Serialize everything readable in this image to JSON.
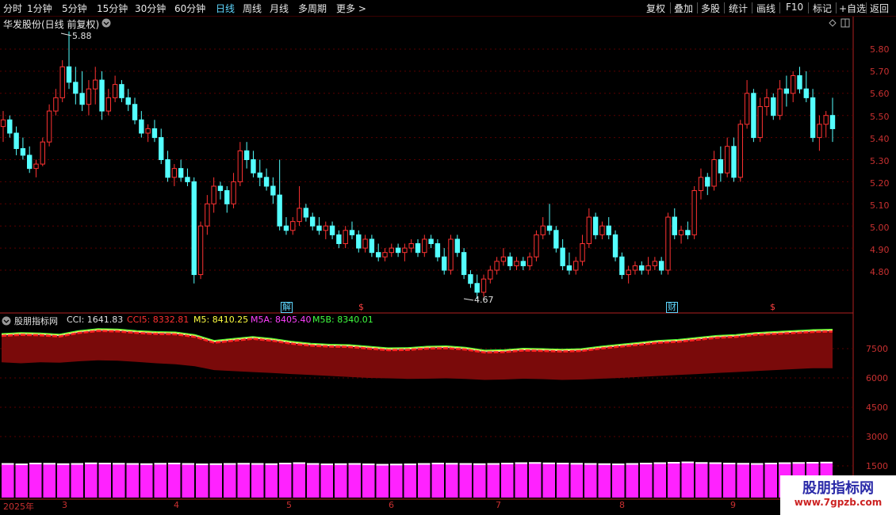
{
  "toolbar": {
    "tabs": [
      "分时",
      "1分钟",
      "5分钟",
      "15分钟",
      "30分钟",
      "60分钟",
      "日线",
      "周线",
      "月线",
      "多周期",
      "更多 >"
    ],
    "active_tab": "日线",
    "right_buttons": [
      "复权",
      "叠加",
      "多股",
      "统计",
      "画线",
      "F10",
      "标记",
      "+自选",
      "返回"
    ]
  },
  "chart_header": {
    "title": "华发股份(日线 前复权)",
    "high_label": "5.88",
    "low_label": "4.67"
  },
  "price_axis": {
    "ticks": [
      "5.80",
      "5.70",
      "5.60",
      "5.50",
      "5.40",
      "5.30",
      "5.20",
      "5.10",
      "5.00",
      "4.90",
      "4.80"
    ]
  },
  "event_markers": [
    {
      "text": "解",
      "color": "#5fd7ff"
    },
    {
      "text": "$",
      "color": "#ff4040"
    },
    {
      "text": "财",
      "color": "#5fd7ff"
    },
    {
      "text": "$",
      "color": "#ff4040"
    }
  ],
  "indicator": {
    "name": "股朋指标网",
    "cci": "CCI: 1641.83",
    "cci5": "CCI5: 8332.81",
    "m5": "M5: 8410.25",
    "m5a": "M5A: 8405.40",
    "m5b": "M5B: 8340.01",
    "colors": {
      "cci": "#e0e0e0",
      "cci5": "#ff3030",
      "m5": "#ffff40",
      "m5a": "#ff40ff",
      "m5b": "#40ff40"
    },
    "axis": [
      "7500",
      "6000",
      "4500",
      "3000",
      "1500"
    ]
  },
  "date_axis": {
    "labels": [
      "2025年",
      "3",
      "4",
      "5",
      "6",
      "7",
      "8",
      "9"
    ]
  },
  "watermark": {
    "title": "股朋指标网",
    "url": "www.7gpzb.com"
  },
  "colors": {
    "up": "#ff3232",
    "down": "#54ffff",
    "grid": "#5a0000",
    "axis": "#c83030",
    "volume": "#ff22ff"
  },
  "chart_data": {
    "type": "candlestick",
    "ylim": [
      4.67,
      5.88
    ],
    "candles": [
      [
        5.45,
        5.52,
        5.38,
        5.48
      ],
      [
        5.48,
        5.5,
        5.4,
        5.42
      ],
      [
        5.42,
        5.45,
        5.32,
        5.35
      ],
      [
        5.35,
        5.4,
        5.3,
        5.32
      ],
      [
        5.32,
        5.36,
        5.24,
        5.26
      ],
      [
        5.26,
        5.3,
        5.22,
        5.28
      ],
      [
        5.28,
        5.4,
        5.27,
        5.38
      ],
      [
        5.38,
        5.55,
        5.36,
        5.52
      ],
      [
        5.52,
        5.62,
        5.5,
        5.58
      ],
      [
        5.58,
        5.75,
        5.56,
        5.72
      ],
      [
        5.72,
        5.88,
        5.62,
        5.65
      ],
      [
        5.65,
        5.72,
        5.55,
        5.6
      ],
      [
        5.6,
        5.7,
        5.52,
        5.55
      ],
      [
        5.55,
        5.66,
        5.5,
        5.62
      ],
      [
        5.62,
        5.72,
        5.55,
        5.66
      ],
      [
        5.66,
        5.7,
        5.48,
        5.52
      ],
      [
        5.52,
        5.62,
        5.5,
        5.58
      ],
      [
        5.58,
        5.68,
        5.56,
        5.64
      ],
      [
        5.64,
        5.66,
        5.56,
        5.58
      ],
      [
        5.58,
        5.62,
        5.52,
        5.55
      ],
      [
        5.55,
        5.58,
        5.46,
        5.48
      ],
      [
        5.48,
        5.52,
        5.4,
        5.42
      ],
      [
        5.42,
        5.46,
        5.38,
        5.44
      ],
      [
        5.44,
        5.48,
        5.38,
        5.4
      ],
      [
        5.4,
        5.44,
        5.28,
        5.3
      ],
      [
        5.3,
        5.34,
        5.2,
        5.22
      ],
      [
        5.22,
        5.28,
        5.18,
        5.26
      ],
      [
        5.26,
        5.3,
        5.2,
        5.22
      ],
      [
        5.22,
        5.26,
        5.18,
        5.2
      ],
      [
        5.2,
        5.22,
        4.74,
        4.78
      ],
      [
        4.78,
        5.02,
        4.76,
        5.0
      ],
      [
        5.0,
        5.14,
        4.96,
        5.1
      ],
      [
        5.1,
        5.22,
        5.06,
        5.18
      ],
      [
        5.18,
        5.2,
        5.12,
        5.16
      ],
      [
        5.16,
        5.18,
        5.06,
        5.1
      ],
      [
        5.1,
        5.24,
        5.08,
        5.2
      ],
      [
        5.2,
        5.38,
        5.18,
        5.34
      ],
      [
        5.34,
        5.38,
        5.26,
        5.3
      ],
      [
        5.3,
        5.34,
        5.22,
        5.24
      ],
      [
        5.24,
        5.3,
        5.18,
        5.22
      ],
      [
        5.22,
        5.26,
        5.16,
        5.18
      ],
      [
        5.18,
        5.22,
        5.1,
        5.14
      ],
      [
        5.14,
        5.3,
        4.98,
        5.0
      ],
      [
        5.0,
        5.04,
        4.96,
        4.98
      ],
      [
        4.98,
        5.04,
        4.96,
        5.02
      ],
      [
        5.02,
        5.18,
        5.0,
        5.08
      ],
      [
        5.08,
        5.1,
        5.02,
        5.04
      ],
      [
        5.04,
        5.06,
        4.98,
        5.0
      ],
      [
        5.0,
        5.04,
        4.96,
        4.98
      ],
      [
        4.98,
        5.02,
        4.94,
        5.0
      ],
      [
        5.0,
        5.02,
        4.94,
        4.96
      ],
      [
        4.96,
        4.98,
        4.9,
        4.92
      ],
      [
        4.92,
        5.0,
        4.9,
        4.98
      ],
      [
        4.98,
        5.02,
        4.94,
        4.96
      ],
      [
        4.96,
        4.98,
        4.88,
        4.9
      ],
      [
        4.9,
        4.96,
        4.88,
        4.94
      ],
      [
        4.94,
        4.96,
        4.86,
        4.88
      ],
      [
        4.88,
        4.92,
        4.84,
        4.86
      ],
      [
        4.86,
        4.9,
        4.84,
        4.88
      ],
      [
        4.88,
        4.92,
        4.86,
        4.9
      ],
      [
        4.9,
        4.92,
        4.86,
        4.88
      ],
      [
        4.88,
        4.92,
        4.84,
        4.9
      ],
      [
        4.9,
        4.94,
        4.88,
        4.92
      ],
      [
        4.92,
        4.94,
        4.86,
        4.88
      ],
      [
        4.88,
        4.96,
        4.86,
        4.94
      ],
      [
        4.94,
        4.96,
        4.9,
        4.92
      ],
      [
        4.92,
        4.94,
        4.84,
        4.86
      ],
      [
        4.86,
        4.9,
        4.78,
        4.8
      ],
      [
        4.8,
        4.96,
        4.78,
        4.94
      ],
      [
        4.94,
        4.96,
        4.86,
        4.88
      ],
      [
        4.88,
        4.9,
        4.76,
        4.78
      ],
      [
        4.78,
        4.8,
        4.72,
        4.74
      ],
      [
        4.74,
        4.78,
        4.67,
        4.7
      ],
      [
        4.7,
        4.78,
        4.68,
        4.76
      ],
      [
        4.76,
        4.82,
        4.74,
        4.8
      ],
      [
        4.8,
        4.86,
        4.78,
        4.84
      ],
      [
        4.84,
        4.9,
        4.82,
        4.86
      ],
      [
        4.86,
        4.88,
        4.8,
        4.82
      ],
      [
        4.82,
        4.86,
        4.8,
        4.84
      ],
      [
        4.84,
        4.86,
        4.8,
        4.82
      ],
      [
        4.82,
        4.88,
        4.8,
        4.86
      ],
      [
        4.86,
        4.98,
        4.84,
        4.96
      ],
      [
        4.96,
        5.04,
        4.94,
        5.0
      ],
      [
        5.0,
        5.1,
        4.96,
        4.98
      ],
      [
        4.98,
        5.0,
        4.88,
        4.9
      ],
      [
        4.9,
        4.94,
        4.8,
        4.82
      ],
      [
        4.82,
        4.88,
        4.78,
        4.8
      ],
      [
        4.8,
        4.86,
        4.78,
        4.84
      ],
      [
        4.84,
        4.96,
        4.82,
        4.92
      ],
      [
        4.92,
        5.08,
        4.9,
        5.04
      ],
      [
        5.04,
        5.06,
        4.94,
        4.96
      ],
      [
        4.96,
        5.02,
        4.94,
        5.0
      ],
      [
        5.0,
        5.04,
        4.94,
        4.96
      ],
      [
        4.96,
        4.98,
        4.84,
        4.86
      ],
      [
        4.86,
        4.88,
        4.76,
        4.78
      ],
      [
        4.78,
        4.82,
        4.74,
        4.8
      ],
      [
        4.8,
        4.84,
        4.78,
        4.82
      ],
      [
        4.82,
        4.84,
        4.78,
        4.8
      ],
      [
        4.8,
        4.86,
        4.78,
        4.82
      ],
      [
        4.82,
        4.86,
        4.8,
        4.84
      ],
      [
        4.84,
        4.86,
        4.78,
        4.8
      ],
      [
        4.8,
        5.06,
        4.78,
        5.04
      ],
      [
        5.04,
        5.08,
        4.94,
        4.96
      ],
      [
        4.96,
        5.0,
        4.92,
        4.98
      ],
      [
        4.98,
        5.02,
        4.94,
        4.96
      ],
      [
        4.96,
        5.18,
        4.94,
        5.16
      ],
      [
        5.16,
        5.26,
        5.12,
        5.22
      ],
      [
        5.22,
        5.24,
        5.14,
        5.18
      ],
      [
        5.18,
        5.34,
        5.16,
        5.3
      ],
      [
        5.3,
        5.36,
        5.2,
        5.24
      ],
      [
        5.24,
        5.4,
        5.22,
        5.36
      ],
      [
        5.36,
        5.4,
        5.2,
        5.22
      ],
      [
        5.22,
        5.48,
        5.2,
        5.46
      ],
      [
        5.46,
        5.66,
        5.44,
        5.6
      ],
      [
        5.6,
        5.62,
        5.38,
        5.4
      ],
      [
        5.4,
        5.58,
        5.38,
        5.54
      ],
      [
        5.54,
        5.62,
        5.5,
        5.58
      ],
      [
        5.58,
        5.6,
        5.48,
        5.5
      ],
      [
        5.5,
        5.66,
        5.48,
        5.62
      ],
      [
        5.62,
        5.68,
        5.54,
        5.6
      ],
      [
        5.6,
        5.7,
        5.56,
        5.68
      ],
      [
        5.68,
        5.72,
        5.6,
        5.62
      ],
      [
        5.62,
        5.7,
        5.56,
        5.58
      ],
      [
        5.58,
        5.62,
        5.38,
        5.4
      ],
      [
        5.4,
        5.5,
        5.34,
        5.46
      ],
      [
        5.46,
        5.52,
        5.4,
        5.5
      ],
      [
        5.5,
        5.58,
        5.38,
        5.44
      ]
    ],
    "indicator_series": {
      "cci5": [
        8150,
        8200,
        8180,
        8120,
        8300,
        8400,
        8380,
        8300,
        8250,
        8230,
        8100,
        7800,
        7900,
        8000,
        7900,
        7750,
        7650,
        7600,
        7580,
        7500,
        7420,
        7430,
        7500,
        7520,
        7450,
        7300,
        7320,
        7400,
        7380,
        7350,
        7380,
        7500,
        7600,
        7700,
        7800,
        7850,
        7950,
        8050,
        8100,
        8200,
        8250,
        8300,
        8350,
        8370
      ],
      "lower": [
        6800,
        6750,
        6800,
        6780,
        6850,
        6900,
        6880,
        6820,
        6750,
        6700,
        6600,
        6400,
        6350,
        6300,
        6250,
        6200,
        6150,
        6100,
        6050,
        6000,
        5980,
        5950,
        5960,
        5980,
        5950,
        5900,
        5920,
        5960,
        5940,
        5900,
        5920,
        5960,
        6000,
        6050,
        6100,
        6150,
        6200,
        6250,
        6300,
        6350,
        6400,
        6450,
        6500,
        6500
      ]
    },
    "volume": [
      1600,
      1580,
      1620,
      1610,
      1590,
      1600,
      1630,
      1620,
      1610,
      1600,
      1590,
      1610,
      1620,
      1600,
      1580,
      1590,
      1600,
      1610,
      1600,
      1590,
      1620,
      1640,
      1600,
      1580,
      1590,
      1600,
      1580,
      1560,
      1570,
      1580,
      1600,
      1620,
      1610,
      1600,
      1590,
      1600,
      1620,
      1640,
      1650,
      1630,
      1620,
      1610,
      1600,
      1590,
      1580,
      1600,
      1620,
      1640,
      1660,
      1680,
      1650,
      1640,
      1620,
      1610,
      1600,
      1620,
      1640,
      1650,
      1660,
      1670
    ]
  }
}
